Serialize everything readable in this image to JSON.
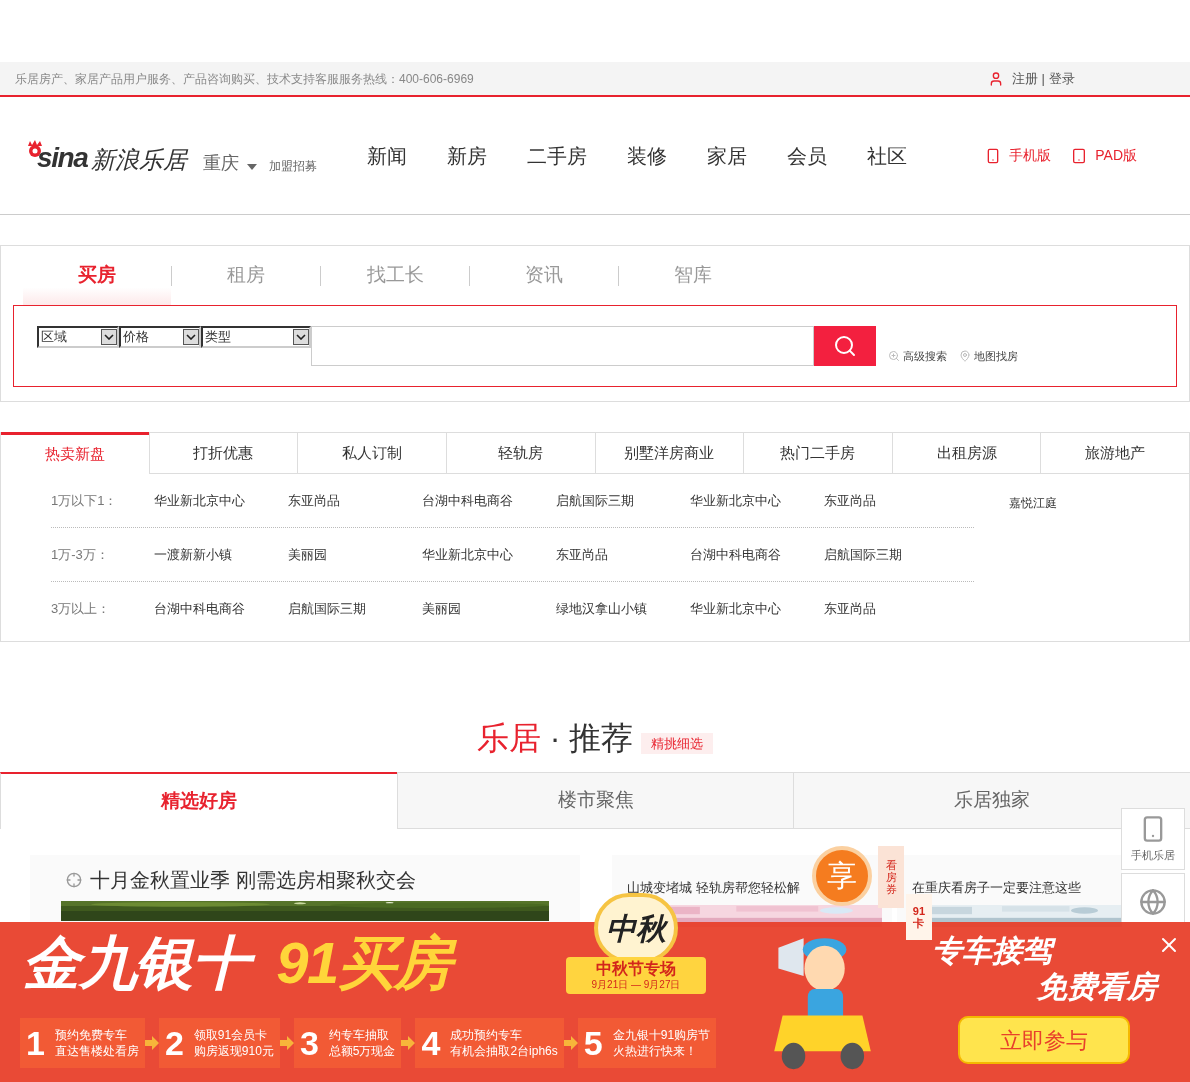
{
  "top_bar": {
    "hotline": "乐居房产、家居产品用户服务、产品咨询购买、技术支持客服服务热线：400-606-6969",
    "register": "注册",
    "separator": "|",
    "login": "登录"
  },
  "header": {
    "logo_mark": "sina",
    "brand": "新浪乐居",
    "city": "重庆",
    "join": "加盟招募",
    "nav": [
      {
        "label": "新闻"
      },
      {
        "label": "新房"
      },
      {
        "label": "二手房"
      },
      {
        "label": "装修"
      },
      {
        "label": "家居"
      },
      {
        "label": "会员"
      },
      {
        "label": "社区"
      }
    ],
    "devices": [
      {
        "kind": "phone",
        "label": "手机版"
      },
      {
        "kind": "tablet",
        "label": "PAD版"
      }
    ]
  },
  "search": {
    "tabs": [
      {
        "label": "买房",
        "selected": true
      },
      {
        "label": "租房",
        "selected": false
      },
      {
        "label": "找工长",
        "selected": false
      },
      {
        "label": "资讯",
        "selected": false
      },
      {
        "label": "智库",
        "selected": false
      }
    ],
    "selects": [
      "区域",
      "价格",
      "类型"
    ],
    "links": [
      {
        "kind": "advanced",
        "label": "高级搜索"
      },
      {
        "kind": "map",
        "label": "地图找房"
      }
    ]
  },
  "hot": {
    "tabs": [
      {
        "label": "热卖新盘",
        "selected": true
      },
      {
        "label": "打折优惠",
        "selected": false
      },
      {
        "label": "私人订制",
        "selected": false
      },
      {
        "label": "轻轨房",
        "selected": false
      },
      {
        "label": "别墅洋房商业",
        "selected": false
      },
      {
        "label": "热门二手房",
        "selected": false
      },
      {
        "label": "出租房源",
        "selected": false
      },
      {
        "label": "旅游地产",
        "selected": false
      }
    ],
    "rows": [
      {
        "label": "1万以下1：",
        "items": [
          "华业新北京中心",
          "东亚尚品",
          "台湖中科电商谷",
          "启航国际三期",
          "华业新北京中心",
          "东亚尚品"
        ]
      },
      {
        "label": "1万-3万：",
        "items": [
          "一渡新新小镇",
          "美丽园",
          "华业新北京中心",
          "东亚尚品",
          "台湖中科电商谷",
          "启航国际三期"
        ]
      },
      {
        "label": "3万以上：",
        "items": [
          "台湖中科电商谷",
          "启航国际三期",
          "美丽园",
          "绿地汉拿山小镇",
          "华业新北京中心",
          "东亚尚品"
        ]
      }
    ],
    "extra": "嘉悦江庭"
  },
  "recommend": {
    "title_accent": "乐居",
    "title_dot": "·",
    "title": "推荐",
    "badge": "精挑细选",
    "tabs": [
      {
        "label": "精选好房",
        "selected": true
      },
      {
        "label": "楼市聚焦",
        "selected": false
      },
      {
        "label": "乐居独家",
        "selected": false
      }
    ],
    "cards": [
      {
        "title": "十月金秋置业季 刚需选房相聚秋交会"
      },
      {
        "title": "山城变堵城 轻轨房帮您轻松解"
      },
      {
        "title": "在重庆看房子一定要注意这些"
      }
    ]
  },
  "side_float": [
    {
      "kind": "phone",
      "label": "手机乐居"
    },
    {
      "kind": "globe"
    }
  ],
  "banner": {
    "headline_1": "金九银十",
    "headline_2": "91买房",
    "festival_mark": "中秋",
    "festival": "中秋节专场",
    "dates": "9月21日 — 9月27日",
    "share": "享",
    "ticket_1": "看房券",
    "ticket_2": "91卡",
    "slogan_1": "专车接驾",
    "slogan_2": "免费看房",
    "cta": "立即参与",
    "steps": [
      {
        "number": "1",
        "line_1": "预约免费专车",
        "line_2": "直达售楼处看房"
      },
      {
        "number": "2",
        "line_1": "领取91会员卡",
        "line_2": "购房返现910元"
      },
      {
        "number": "3",
        "line_1": "约专车抽取",
        "line_2": "总额5万现金"
      },
      {
        "number": "4",
        "line_1": "成功预约专车",
        "line_2": "有机会抽取2台iph6s"
      },
      {
        "number": "5",
        "line_1": "金九银十91购房节",
        "line_2": "火热进行快来！"
      }
    ]
  }
}
